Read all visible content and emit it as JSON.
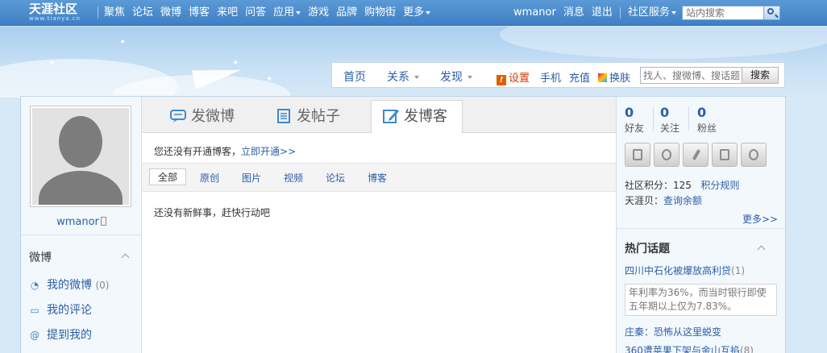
{
  "topnav": {
    "logo": "天涯社区",
    "logo_sub": "www.tianya.cn",
    "links": [
      "聚焦",
      "论坛",
      "微博",
      "博客",
      "来吧",
      "问答",
      "应用",
      "游戏",
      "品牌",
      "购物街",
      "更多"
    ],
    "dropdowns": [
      "应用",
      "更多"
    ],
    "username": "wmanor",
    "messages": "消息",
    "logout": "退出",
    "community_services": "社区服务",
    "search_placeholder": "站内搜索"
  },
  "subnav": {
    "home": "首页",
    "relations": "关系",
    "discover": "发现",
    "settings": "设置",
    "mobile": "手机",
    "recharge": "充值",
    "skin": "换肤",
    "search_placeholder": "找人、搜微博、搜话题",
    "search_button": "搜索"
  },
  "profile": {
    "username": "wmanor",
    "section_title": "微博",
    "items": [
      {
        "label": "我的微博",
        "count": "(0)"
      },
      {
        "label": "我的评论",
        "count": ""
      },
      {
        "label": "提到我的",
        "count": ""
      }
    ]
  },
  "publish": {
    "tabs": [
      "发微博",
      "发帖子",
      "发博客"
    ],
    "active_tab": "发博客",
    "notice_text": "您还没有开通博客，",
    "notice_link": "立即开通>>",
    "filters": [
      "全部",
      "原创",
      "图片",
      "视频",
      "论坛",
      "博客"
    ],
    "active_filter": "全部",
    "empty_text": "还没有新鲜事，赶快行动吧"
  },
  "stats": {
    "friends": {
      "value": "0",
      "label": "好友"
    },
    "following": {
      "value": "0",
      "label": "关注"
    },
    "fans": {
      "value": "0",
      "label": "粉丝"
    },
    "points_label": "社区积分：",
    "points_value": "125",
    "points_rule": "积分规则",
    "shell_label": "天涯贝：",
    "shell_link": "查询余额",
    "more": "更多>>"
  },
  "hot_topics": {
    "title": "热门话题",
    "topics": [
      {
        "title": "四川中石化被爆放高利贷",
        "count": "(1)"
      },
      {
        "title": "庄秦：恐怖从这里蜕变",
        "count": ""
      },
      {
        "title": "360遭苹果下架与金山互掐",
        "count": "(8)"
      }
    ],
    "first_desc": "年利率为36%，而当时银行即使五年期以上仅为7.83%。"
  },
  "colors": {
    "link": "#2b5fa6",
    "topbar": "#4a8acb",
    "background": "#d7e8f6"
  }
}
